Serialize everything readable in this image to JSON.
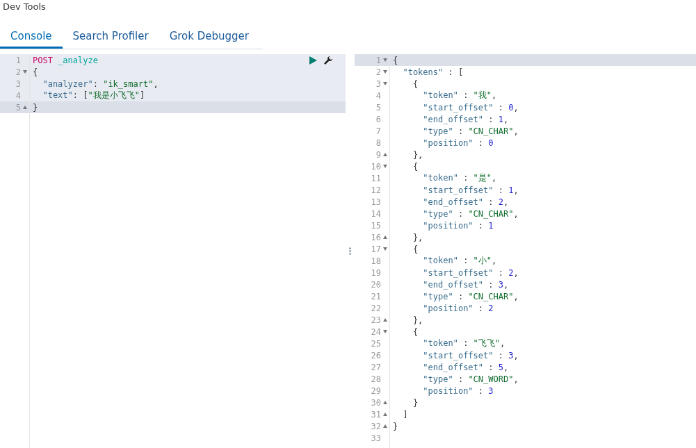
{
  "app_title": "Dev Tools",
  "tabs": [
    {
      "label": "Console",
      "selected": true
    },
    {
      "label": "Search Profiler",
      "selected": false
    },
    {
      "label": "Grok Debugger",
      "selected": false
    }
  ],
  "request_editor": {
    "lines": [
      {
        "number": "1",
        "highlighted": true,
        "segments": [
          {
            "kind": "keyword",
            "text": "POST "
          },
          {
            "kind": "path",
            "text": "_analyze"
          }
        ]
      },
      {
        "number": "2",
        "fold_start": true,
        "highlighted": true,
        "segments": [
          {
            "kind": "punct",
            "text": "{"
          }
        ]
      },
      {
        "number": "3",
        "highlighted": true,
        "segments": [
          {
            "kind": "key",
            "text": "  \"analyzer\""
          },
          {
            "kind": "punct",
            "text": ": "
          },
          {
            "kind": "string",
            "text": "\"ik_smart\""
          },
          {
            "kind": "punct",
            "text": ","
          }
        ]
      },
      {
        "number": "4",
        "highlighted": true,
        "segments": [
          {
            "kind": "key",
            "text": "  \"text\""
          },
          {
            "kind": "punct",
            "text": ": ["
          },
          {
            "kind": "string",
            "text": "\"我是小飞飞\""
          },
          {
            "kind": "punct",
            "text": "]"
          }
        ]
      },
      {
        "number": "5",
        "fold_start": false,
        "cursor": true,
        "segments": [
          {
            "kind": "punct",
            "text": "}"
          }
        ]
      }
    ]
  },
  "response_editor": {
    "lines": [
      {
        "number": "1",
        "fold_start": true,
        "cursor": true,
        "segments": [
          {
            "kind": "punct",
            "text": "{"
          }
        ]
      },
      {
        "number": "2",
        "fold_start": true,
        "segments": [
          {
            "kind": "key",
            "text": "  \"tokens\""
          },
          {
            "kind": "punct",
            "text": " : ["
          }
        ]
      },
      {
        "number": "3",
        "fold_start": true,
        "segments": [
          {
            "kind": "punct",
            "text": "    {"
          }
        ]
      },
      {
        "number": "4",
        "segments": [
          {
            "kind": "key",
            "text": "      \"token\""
          },
          {
            "kind": "punct",
            "text": " : "
          },
          {
            "kind": "string",
            "text": "\"我\""
          },
          {
            "kind": "punct",
            "text": ","
          }
        ]
      },
      {
        "number": "5",
        "segments": [
          {
            "kind": "key",
            "text": "      \"start_offset\""
          },
          {
            "kind": "punct",
            "text": " : "
          },
          {
            "kind": "number",
            "text": "0"
          },
          {
            "kind": "punct",
            "text": ","
          }
        ]
      },
      {
        "number": "6",
        "segments": [
          {
            "kind": "key",
            "text": "      \"end_offset\""
          },
          {
            "kind": "punct",
            "text": " : "
          },
          {
            "kind": "number",
            "text": "1"
          },
          {
            "kind": "punct",
            "text": ","
          }
        ]
      },
      {
        "number": "7",
        "segments": [
          {
            "kind": "key",
            "text": "      \"type\""
          },
          {
            "kind": "punct",
            "text": " : "
          },
          {
            "kind": "string",
            "text": "\"CN_CHAR\""
          },
          {
            "kind": "punct",
            "text": ","
          }
        ]
      },
      {
        "number": "8",
        "segments": [
          {
            "kind": "key",
            "text": "      \"position\""
          },
          {
            "kind": "punct",
            "text": " : "
          },
          {
            "kind": "number",
            "text": "0"
          }
        ]
      },
      {
        "number": "9",
        "fold_start": false,
        "segments": [
          {
            "kind": "punct",
            "text": "    },"
          }
        ]
      },
      {
        "number": "10",
        "fold_start": true,
        "segments": [
          {
            "kind": "punct",
            "text": "    {"
          }
        ]
      },
      {
        "number": "11",
        "segments": [
          {
            "kind": "key",
            "text": "      \"token\""
          },
          {
            "kind": "punct",
            "text": " : "
          },
          {
            "kind": "string",
            "text": "\"是\""
          },
          {
            "kind": "punct",
            "text": ","
          }
        ]
      },
      {
        "number": "12",
        "segments": [
          {
            "kind": "key",
            "text": "      \"start_offset\""
          },
          {
            "kind": "punct",
            "text": " : "
          },
          {
            "kind": "number",
            "text": "1"
          },
          {
            "kind": "punct",
            "text": ","
          }
        ]
      },
      {
        "number": "13",
        "segments": [
          {
            "kind": "key",
            "text": "      \"end_offset\""
          },
          {
            "kind": "punct",
            "text": " : "
          },
          {
            "kind": "number",
            "text": "2"
          },
          {
            "kind": "punct",
            "text": ","
          }
        ]
      },
      {
        "number": "14",
        "segments": [
          {
            "kind": "key",
            "text": "      \"type\""
          },
          {
            "kind": "punct",
            "text": " : "
          },
          {
            "kind": "string",
            "text": "\"CN_CHAR\""
          },
          {
            "kind": "punct",
            "text": ","
          }
        ]
      },
      {
        "number": "15",
        "segments": [
          {
            "kind": "key",
            "text": "      \"position\""
          },
          {
            "kind": "punct",
            "text": " : "
          },
          {
            "kind": "number",
            "text": "1"
          }
        ]
      },
      {
        "number": "16",
        "fold_start": false,
        "segments": [
          {
            "kind": "punct",
            "text": "    },"
          }
        ]
      },
      {
        "number": "17",
        "fold_start": true,
        "segments": [
          {
            "kind": "punct",
            "text": "    {"
          }
        ]
      },
      {
        "number": "18",
        "segments": [
          {
            "kind": "key",
            "text": "      \"token\""
          },
          {
            "kind": "punct",
            "text": " : "
          },
          {
            "kind": "string",
            "text": "\"小\""
          },
          {
            "kind": "punct",
            "text": ","
          }
        ]
      },
      {
        "number": "19",
        "segments": [
          {
            "kind": "key",
            "text": "      \"start_offset\""
          },
          {
            "kind": "punct",
            "text": " : "
          },
          {
            "kind": "number",
            "text": "2"
          },
          {
            "kind": "punct",
            "text": ","
          }
        ]
      },
      {
        "number": "20",
        "segments": [
          {
            "kind": "key",
            "text": "      \"end_offset\""
          },
          {
            "kind": "punct",
            "text": " : "
          },
          {
            "kind": "number",
            "text": "3"
          },
          {
            "kind": "punct",
            "text": ","
          }
        ]
      },
      {
        "number": "21",
        "segments": [
          {
            "kind": "key",
            "text": "      \"type\""
          },
          {
            "kind": "punct",
            "text": " : "
          },
          {
            "kind": "string",
            "text": "\"CN_CHAR\""
          },
          {
            "kind": "punct",
            "text": ","
          }
        ]
      },
      {
        "number": "22",
        "segments": [
          {
            "kind": "key",
            "text": "      \"position\""
          },
          {
            "kind": "punct",
            "text": " : "
          },
          {
            "kind": "number",
            "text": "2"
          }
        ]
      },
      {
        "number": "23",
        "fold_start": false,
        "segments": [
          {
            "kind": "punct",
            "text": "    },"
          }
        ]
      },
      {
        "number": "24",
        "fold_start": true,
        "segments": [
          {
            "kind": "punct",
            "text": "    {"
          }
        ]
      },
      {
        "number": "25",
        "segments": [
          {
            "kind": "key",
            "text": "      \"token\""
          },
          {
            "kind": "punct",
            "text": " : "
          },
          {
            "kind": "string",
            "text": "\"飞飞\""
          },
          {
            "kind": "punct",
            "text": ","
          }
        ]
      },
      {
        "number": "26",
        "segments": [
          {
            "kind": "key",
            "text": "      \"start_offset\""
          },
          {
            "kind": "punct",
            "text": " : "
          },
          {
            "kind": "number",
            "text": "3"
          },
          {
            "kind": "punct",
            "text": ","
          }
        ]
      },
      {
        "number": "27",
        "segments": [
          {
            "kind": "key",
            "text": "      \"end_offset\""
          },
          {
            "kind": "punct",
            "text": " : "
          },
          {
            "kind": "number",
            "text": "5"
          },
          {
            "kind": "punct",
            "text": ","
          }
        ]
      },
      {
        "number": "28",
        "segments": [
          {
            "kind": "key",
            "text": "      \"type\""
          },
          {
            "kind": "punct",
            "text": " : "
          },
          {
            "kind": "string",
            "text": "\"CN_WORD\""
          },
          {
            "kind": "punct",
            "text": ","
          }
        ]
      },
      {
        "number": "29",
        "segments": [
          {
            "kind": "key",
            "text": "      \"position\""
          },
          {
            "kind": "punct",
            "text": " : "
          },
          {
            "kind": "number",
            "text": "3"
          }
        ]
      },
      {
        "number": "30",
        "fold_start": false,
        "segments": [
          {
            "kind": "punct",
            "text": "    }"
          }
        ]
      },
      {
        "number": "31",
        "fold_start": false,
        "segments": [
          {
            "kind": "punct",
            "text": "  ]"
          }
        ]
      },
      {
        "number": "32",
        "fold_start": false,
        "segments": [
          {
            "kind": "punct",
            "text": "}"
          }
        ]
      },
      {
        "number": "33"
      }
    ]
  }
}
